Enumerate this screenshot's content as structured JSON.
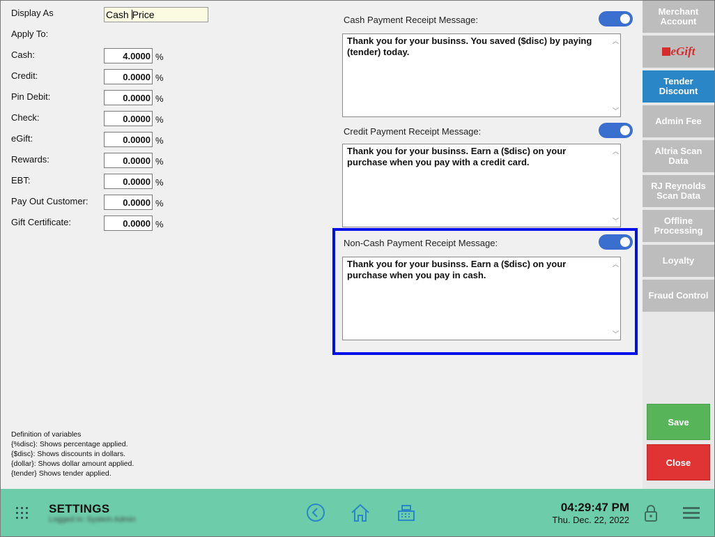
{
  "form": {
    "display_as_label": "Display As",
    "display_as_value_1": "Cash ",
    "display_as_value_2": "Price",
    "apply_to_label": "Apply To:",
    "percent_sign": "%",
    "rows": [
      {
        "label": "Cash:",
        "value": "4.0000"
      },
      {
        "label": "Credit:",
        "value": "0.0000"
      },
      {
        "label": "Pin Debit:",
        "value": "0.0000"
      },
      {
        "label": "Check:",
        "value": "0.0000"
      },
      {
        "label": "eGift:",
        "value": "0.0000"
      },
      {
        "label": "Rewards:",
        "value": "0.0000"
      },
      {
        "label": "EBT:",
        "value": "0.0000"
      },
      {
        "label": "Pay Out Customer:",
        "value": "0.0000"
      },
      {
        "label": "Gift Certificate:",
        "value": "0.0000"
      }
    ]
  },
  "definitions": {
    "title": "Definition of variables",
    "lines": [
      "{%disc}: Shows percentage applied.",
      "{$disc}:  Shows discounts in dollars.",
      "{dollar}: Shows dollar amount applied.",
      "{tender} Shows tender applied."
    ]
  },
  "messages": {
    "cash": {
      "label": "Cash Payment Receipt Message:",
      "text": "Thank you for your businss. You saved ($disc) by paying (tender) today.",
      "enabled": true
    },
    "credit": {
      "label": "Credit Payment Receipt Message:",
      "text": "Thank you for your businss. Earn a ($disc) on your purchase when you pay with a credit card.",
      "enabled": true
    },
    "noncash": {
      "label": "Non-Cash Payment Receipt Message:",
      "text": "Thank you for your businss. Earn a ($disc) on your purchase when you pay in cash.",
      "enabled": true
    }
  },
  "sidebar": {
    "items": [
      {
        "label": "Merchant Account"
      },
      {
        "label": "eGift"
      },
      {
        "label": "Tender Discount",
        "active": true
      },
      {
        "label": "Admin Fee"
      },
      {
        "label": "Altria Scan Data"
      },
      {
        "label": "RJ Reynolds Scan Data"
      },
      {
        "label": "Offline Processing"
      },
      {
        "label": "Loyalty"
      },
      {
        "label": "Fraud Control"
      }
    ],
    "save_label": "Save",
    "close_label": "Close"
  },
  "bottom_bar": {
    "title": "SETTINGS",
    "subtitle": "Logged in: System Admin",
    "time": "04:29:47 PM",
    "date": "Thu. Dec. 22, 2022"
  },
  "colors": {
    "accent_blue": "#2a86c6",
    "toggle_blue": "#3a6fd0",
    "highlight": "#0010e8",
    "bottom_bar": "#6dcdaa",
    "save_green": "#58b459",
    "close_red": "#e03434"
  }
}
